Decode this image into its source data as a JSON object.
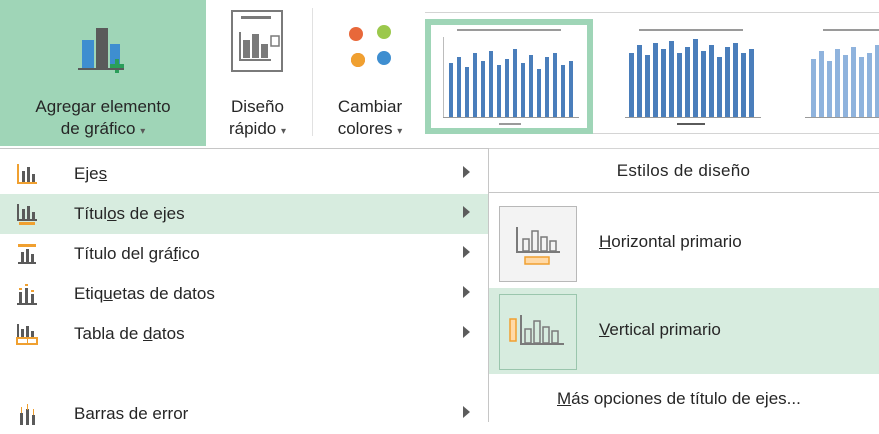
{
  "ribbon": {
    "add_element": {
      "line1": "Agregar elemento",
      "line2": "de gráfico",
      "caret": "▾"
    },
    "quick_layout": {
      "line1": "Diseño",
      "line2": "rápido",
      "caret": "▾"
    },
    "change_colors": {
      "line1": "Cambiar",
      "line2": "colores",
      "caret": "▾"
    },
    "gallery_label": "Estilos de diseño"
  },
  "menu": {
    "items": [
      {
        "pre": "Eje",
        "key": "s",
        "post": "",
        "icon": "axes-icon"
      },
      {
        "pre": "Títul",
        "key": "o",
        "post": "s de ejes",
        "icon": "axis-titles-icon"
      },
      {
        "pre": "Título del grá",
        "key": "f",
        "post": "ico",
        "icon": "chart-title-icon"
      },
      {
        "pre": "Etiq",
        "key": "u",
        "post": "etas de datos",
        "icon": "data-labels-icon"
      },
      {
        "pre": "Tabla de ",
        "key": "d",
        "post": "atos",
        "icon": "data-table-icon"
      },
      {
        "pre": "Barras de error",
        "key": "",
        "post": "",
        "icon": "error-bars-icon"
      }
    ]
  },
  "submenu": {
    "horizontal": {
      "key": "H",
      "rest": "orizontal primario"
    },
    "vertical": {
      "key": "V",
      "rest": "ertical primario"
    },
    "more": {
      "key": "M",
      "rest": "ás opciones de título de ejes..."
    }
  },
  "colors": {
    "accent": "#9fd5b7",
    "hover": "#d7ecdf",
    "bar_blue": "#4a7ebb",
    "highlight_orange": "#f0a030"
  }
}
